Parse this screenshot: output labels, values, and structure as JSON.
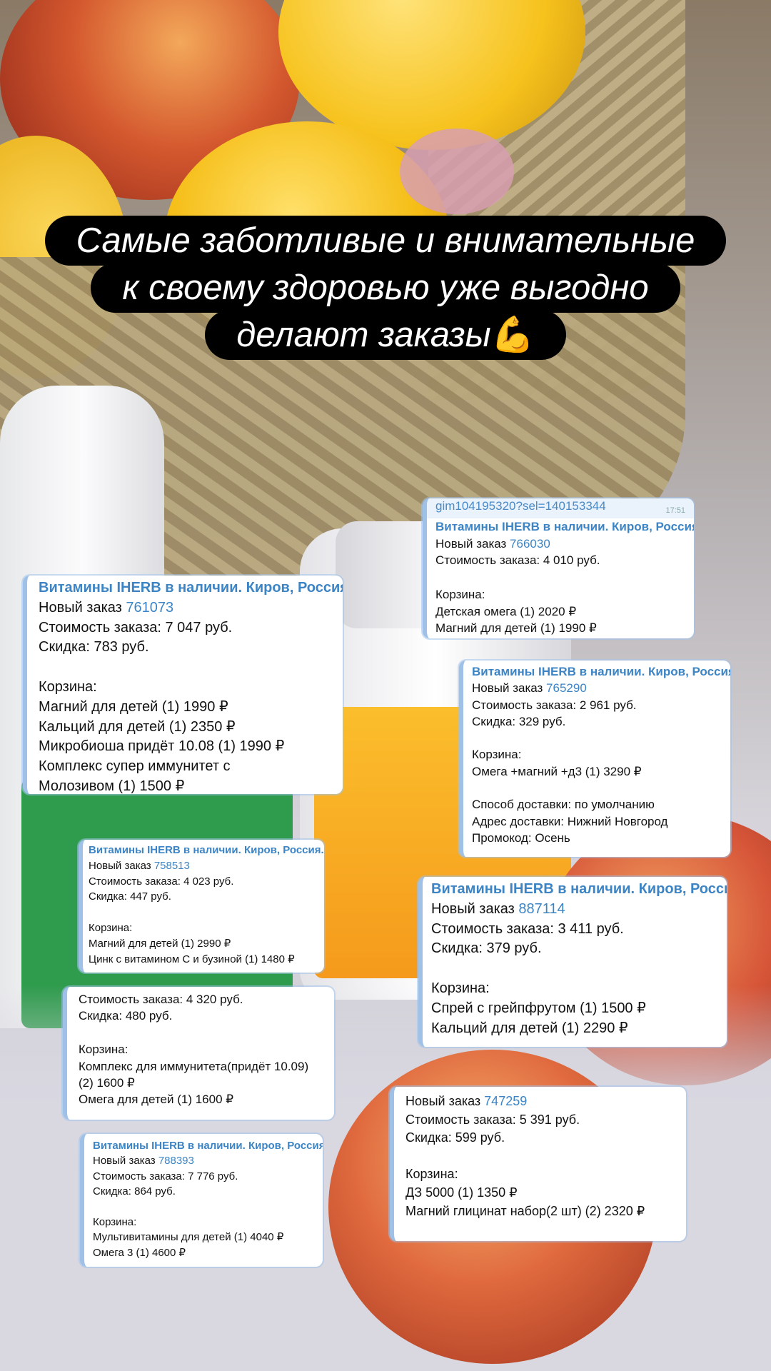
{
  "headline": {
    "line1": "Самые заботливые и внимательные",
    "line2": "к своему здоровью уже выгодно",
    "line3": "делают заказы",
    "emoji": "💪"
  },
  "source_label": "Витамины IHERB в наличии. Киров, Россия. DSP",
  "cards": [
    {
      "id": "c1",
      "order_prefix": "Новый заказ ",
      "order_number": "761073",
      "lines": [
        "Стоимость заказа: 7 047 руб.",
        "Скидка: 783 руб."
      ],
      "basket_title": "Корзина:",
      "items": [
        "Магний для детей (1) 1990 ₽",
        "Кальций   для детей (1) 2350 ₽",
        "Микробиоша придёт 10.08 (1) 1990 ₽",
        "Комплекс супер иммунитет с",
        "Молозивом (1) 1500 ₽"
      ]
    },
    {
      "id": "c2",
      "link_text": "gim104195320?sel=140153344",
      "time": "17:51",
      "order_prefix": "Новый заказ ",
      "order_number": "766030",
      "lines": [
        "Стоимость заказа: 4 010 руб."
      ],
      "basket_title": "Корзина:",
      "items": [
        "Детская омега (1) 2020 ₽",
        "Магний для детей (1) 1990 ₽"
      ]
    },
    {
      "id": "c3",
      "order_prefix": "Новый заказ ",
      "order_number": "765290",
      "lines": [
        "Стоимость заказа: 2 961 руб.",
        "Скидка: 329 руб."
      ],
      "basket_title": "Корзина:",
      "items": [
        "Омега +магний +д3 (1) 3290 ₽"
      ],
      "extra": [
        "Способ доставки: по умолчанию",
        "Адрес доставки: Нижний Новгород",
        "Промокод: Осень"
      ]
    },
    {
      "id": "c4",
      "order_prefix": "Новый заказ ",
      "order_number": "758513",
      "lines": [
        "Стоимость заказа: 4 023 руб.",
        "Скидка: 447 руб."
      ],
      "basket_title": "Корзина:",
      "items": [
        "Магний для детей (1) 2990 ₽",
        "Цинк с витамином С и бузиной (1) 1480 ₽"
      ]
    },
    {
      "id": "c5",
      "order_prefix": "Новый заказ ",
      "order_number": "887114",
      "lines": [
        "Стоимость заказа: 3 411 руб.",
        "Скидка: 379 руб."
      ],
      "basket_title": "Корзина:",
      "items": [
        "Спрей с грейпфрутом (1) 1500 ₽",
        "Кальций для детей (1) 2290 ₽"
      ]
    },
    {
      "id": "c6",
      "lines": [
        "Стоимость заказа: 4 320 руб.",
        "Скидка: 480 руб."
      ],
      "basket_title": "Корзина:",
      "items": [
        "Комплекс для иммунитета(придёт 10.09)",
        "(2) 1600 ₽",
        "Омега для детей (1) 1600 ₽"
      ]
    },
    {
      "id": "c7",
      "order_prefix": "Новый заказ ",
      "order_number": "747259",
      "lines": [
        "Стоимость заказа: 5 391 руб.",
        "Скидка: 599 руб."
      ],
      "basket_title": "Корзина:",
      "items": [
        "ДЗ 5000 (1) 1350 ₽",
        "Магний глицинат набор(2 шт) (2) 2320 ₽"
      ]
    },
    {
      "id": "c8",
      "order_prefix": "Новый заказ ",
      "order_number": "788393",
      "lines": [
        "Стоимость заказа: 7 776 руб.",
        "Скидка: 864 руб."
      ],
      "basket_title": "Корзина:",
      "items": [
        "Мультивитамины для детей (1) 4040 ₽",
        "Омега 3 (1) 4600 ₽"
      ]
    }
  ],
  "colors": {
    "accent": "#3c84c4",
    "card_border": "#9fc1e8",
    "headline_bg": "#000000",
    "headline_text": "#ffffff"
  }
}
